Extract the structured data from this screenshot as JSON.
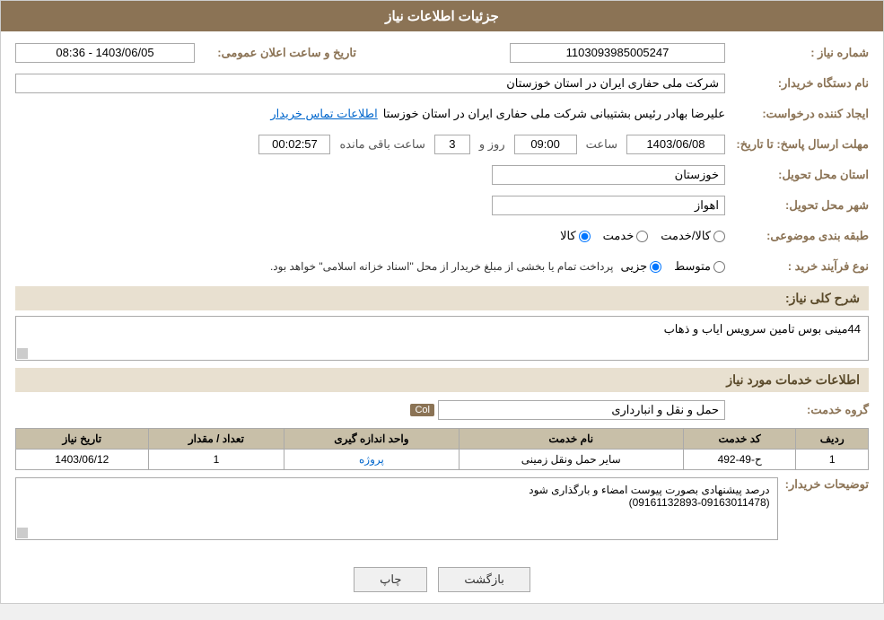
{
  "header": {
    "title": "جزئیات اطلاعات نیاز"
  },
  "fields": {
    "need_number_label": "شماره نیاز :",
    "need_number_value": "1103093985005247",
    "buyer_org_label": "نام دستگاه خریدار:",
    "buyer_org_value": "شرکت ملی حفاری ایران در استان خوزستان",
    "creator_label": "ایجاد کننده درخواست:",
    "creator_value": "علیرضا بهادر رئیس بشتیبانی شرکت ملی حفاری ایران در استان خوزستا",
    "contact_link": "اطلاعات تماس خریدار",
    "announce_date_label": "تاریخ و ساعت اعلان عمومی:",
    "announce_date_value": "1403/06/05 - 08:36",
    "deadline_label": "مهلت ارسال پاسخ: تا تاریخ:",
    "deadline_date": "1403/06/08",
    "deadline_time_label": "ساعت",
    "deadline_time": "09:00",
    "deadline_days_label": "روز و",
    "deadline_days": "3",
    "deadline_remaining_label": "ساعت باقی مانده",
    "deadline_remaining": "00:02:57",
    "province_label": "استان محل تحویل:",
    "province_value": "خوزستان",
    "city_label": "شهر محل تحویل:",
    "city_value": "اهواز",
    "category_label": "طبقه بندی موضوعی:",
    "category_options": [
      "کالا",
      "خدمت",
      "کالا/خدمت"
    ],
    "category_selected": "کالا",
    "purchase_type_label": "نوع فرآیند خرید :",
    "purchase_type_options": [
      "جزیی",
      "متوسط"
    ],
    "purchase_type_text": "پرداخت تمام یا بخشی از مبلغ خریدار از محل \"اسناد خزانه اسلامی\" خواهد بود.",
    "need_description_label": "شرح کلی نیاز:",
    "need_description_value": "44مینی بوس تامین سرویس ایاب و ذهاب",
    "service_info_title": "اطلاعات خدمات مورد نیاز",
    "service_group_label": "گروه خدمت:",
    "service_group_value": "حمل و نقل و انبارداری"
  },
  "table": {
    "headers": [
      "ردیف",
      "کد خدمت",
      "نام خدمت",
      "واحد اندازه گیری",
      "تعداد / مقدار",
      "تاریخ نیاز"
    ],
    "rows": [
      {
        "row": "1",
        "code": "ح-49-492",
        "name": "سایر حمل ونقل زمینی",
        "unit": "پروژه",
        "quantity": "1",
        "date": "1403/06/12"
      }
    ]
  },
  "buyer_description_label": "توضیحات خریدار:",
  "buyer_description_value": "درصد پیشنهادی بصورت پیوست امضاء و بارگذاری شود\n(09161132893-09163011478)",
  "buttons": {
    "print": "چاپ",
    "back": "بازگشت"
  },
  "col_tag": "Col"
}
